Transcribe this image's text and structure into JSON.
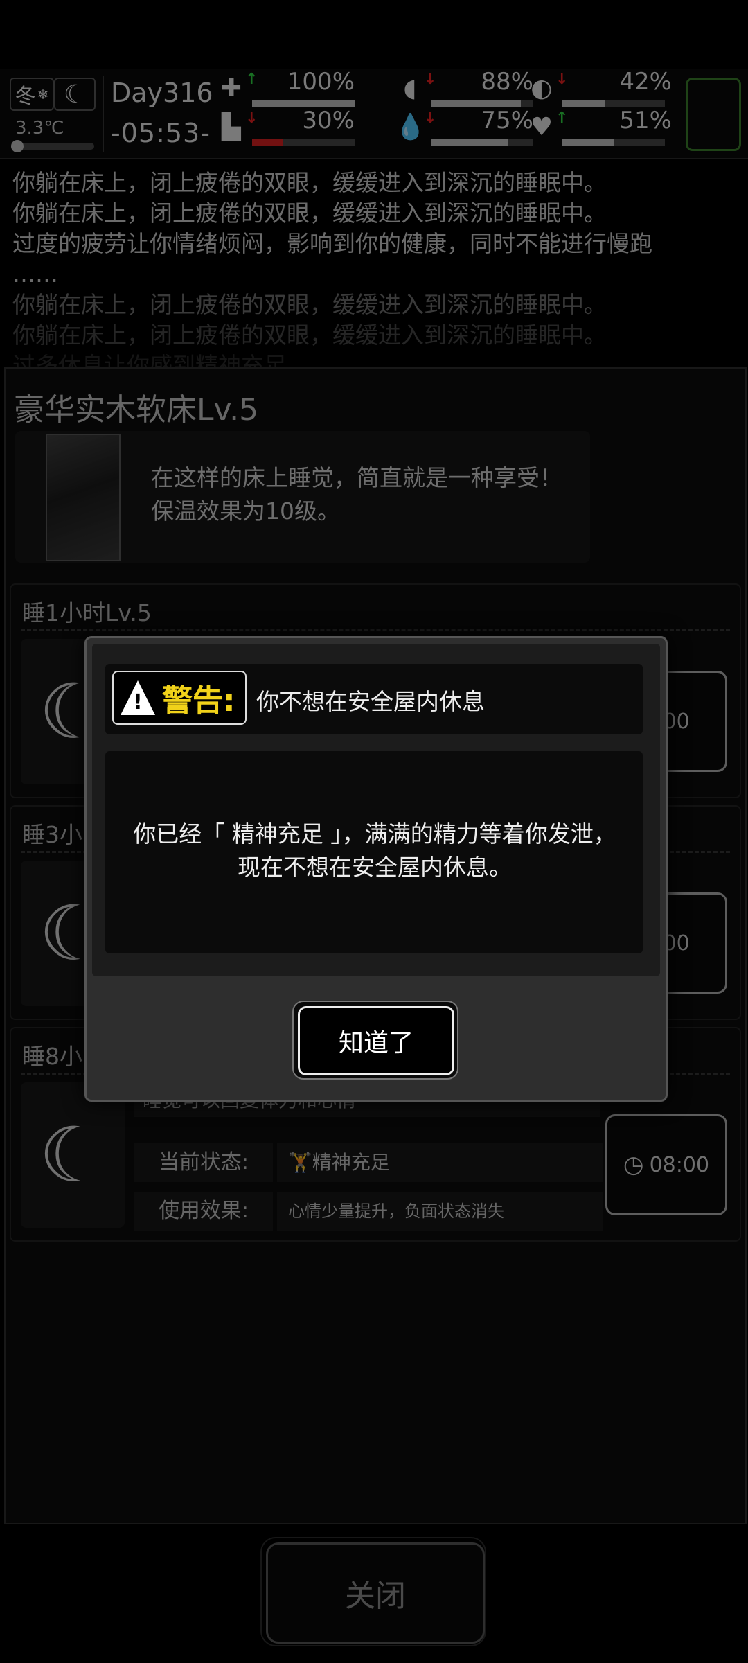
{
  "hud": {
    "season": "冬",
    "season_icon": "snowflake-icon",
    "moon_icon": "moon-icon",
    "temperature": "3.3℃",
    "day": "Day316",
    "time": "-05:53-",
    "stats": [
      {
        "icon": "medkit-icon",
        "glyph": "✚",
        "arrow": "↑",
        "arrow_color": "#2ecc40",
        "value": "100%",
        "fill": 1.0,
        "bar_color": "#bbbbbb"
      },
      {
        "icon": "stomach-icon",
        "glyph": "◖",
        "arrow": "↓",
        "arrow_color": "#e02020",
        "value": "88%",
        "fill": 0.88,
        "bar_color": "#bbbbbb"
      },
      {
        "icon": "pill-icon",
        "glyph": "◐",
        "arrow": "↓",
        "arrow_color": "#e02020",
        "value": "42%",
        "fill": 0.42,
        "bar_color": "#bbbbbb"
      },
      {
        "icon": "boot-icon",
        "glyph": "▙",
        "arrow": "↓",
        "arrow_color": "#e02020",
        "value": "30%",
        "fill": 0.3,
        "bar_color": "#d02020"
      },
      {
        "icon": "water-drop-icon",
        "glyph": "💧",
        "arrow": "↓",
        "arrow_color": "#e02020",
        "value": "75%",
        "fill": 0.75,
        "bar_color": "#bbbbbb"
      },
      {
        "icon": "heart-icon",
        "glyph": "♥",
        "arrow": "↑",
        "arrow_color": "#2ecc40",
        "value": "51%",
        "fill": 0.51,
        "bar_color": "#bbbbbb"
      }
    ]
  },
  "log": [
    "你躺在床上，闭上疲倦的双眼，缓缓进入到深沉的睡眠中。",
    "你躺在床上，闭上疲倦的双眼，缓缓进入到深沉的睡眠中。",
    "过度的疲劳让你情绪烦闷，影响到你的健康，同时不能进行慢跑",
    "……",
    "你躺在床上，闭上疲倦的双眼，缓缓进入到深沉的睡眠中。",
    "你躺在床上，闭上疲倦的双眼，缓缓进入到深沉的睡眠中。",
    "过多休息让你感到精神充足。"
  ],
  "bed": {
    "title": "豪华实木软床Lv.5",
    "description": "在这样的床上睡觉，简直就是一种享受！保温效果为10级。"
  },
  "options": [
    {
      "title": "睡1小时Lv.5",
      "time": "1:00"
    },
    {
      "title": "睡3小",
      "time": "3:00"
    },
    {
      "title": "睡8小",
      "time": "08:00",
      "desc": "睡觉可以回复体力和心情",
      "state_label": "当前状态:",
      "state_value": "精神充足",
      "effect_label": "使用效果:",
      "effect_value": "心情少量提升，负面状态消失"
    }
  ],
  "close_label": "关闭",
  "dialog": {
    "warning_label": "警告:",
    "warning_text": "你不想在安全屋内休息",
    "message": "你已经「 精神充足 」，满满的精力等着你发泄，现在不想在安全屋内休息。",
    "ok_label": "知道了"
  }
}
